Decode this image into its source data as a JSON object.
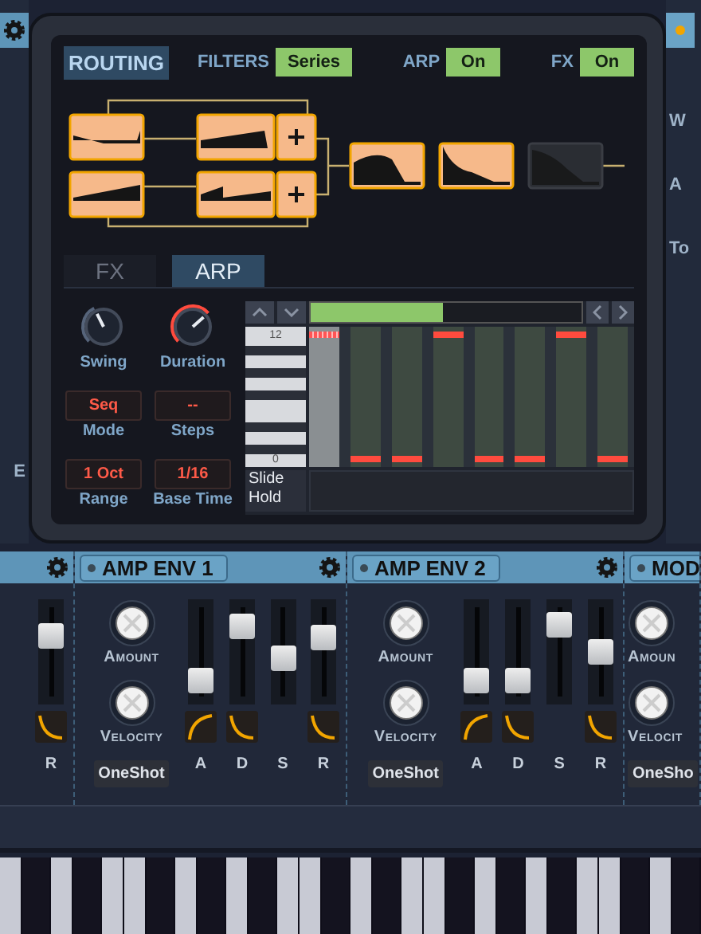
{
  "side_left": {
    "labels": [
      "E"
    ]
  },
  "side_right": {
    "labels": [
      "W",
      "A",
      "To"
    ]
  },
  "routing": {
    "title": "ROUTING",
    "toggles": [
      {
        "label": "FILTERS",
        "value": "Series"
      },
      {
        "label": "ARP",
        "value": "On"
      },
      {
        "label": "FX",
        "value": "On"
      }
    ]
  },
  "tabs": [
    {
      "label": "FX",
      "selected": false
    },
    {
      "label": "ARP",
      "selected": true
    }
  ],
  "arp": {
    "knobs": [
      {
        "label": "Swing",
        "level": 0.4,
        "accent": false
      },
      {
        "label": "Duration",
        "level": 0.68,
        "accent": true
      }
    ],
    "fields": [
      {
        "value": "Seq",
        "label": "Mode"
      },
      {
        "value": "--",
        "label": "Steps"
      },
      {
        "value": "1 Oct",
        "label": "Range"
      },
      {
        "value": "1/16",
        "label": "Base Time"
      }
    ]
  },
  "sequencer": {
    "position": {
      "level": 0.49
    },
    "key_labels": [
      "12",
      "0"
    ],
    "steps": [
      {
        "selected": true,
        "high": true
      },
      {
        "selected": false,
        "high": false
      },
      {
        "selected": false,
        "high": false
      },
      {
        "selected": false,
        "high": true
      },
      {
        "selected": false,
        "high": false
      },
      {
        "selected": false,
        "high": false
      },
      {
        "selected": false,
        "high": true
      },
      {
        "selected": false,
        "high": false
      }
    ],
    "rows": [
      "Slide",
      "Hold"
    ]
  },
  "modules": [
    {
      "kind": "partial-left",
      "sliders": [
        {
          "label": "R",
          "level": 0.7,
          "kind": "fall"
        }
      ]
    },
    {
      "kind": "envelope",
      "title": "AMP ENV 1",
      "knobs": [
        "Amount",
        "Velocity"
      ],
      "button": "OneShot",
      "sliders": [
        {
          "label": "A",
          "level": 0.15,
          "kind": "rise"
        },
        {
          "label": "D",
          "level": 0.82,
          "kind": "fall"
        },
        {
          "label": "S",
          "level": 0.42,
          "kind": "flat"
        },
        {
          "label": "R",
          "level": 0.68,
          "kind": "fall"
        }
      ]
    },
    {
      "kind": "envelope",
      "title": "AMP ENV 2",
      "knobs": [
        "Amount",
        "Velocity"
      ],
      "button": "OneShot",
      "sliders": [
        {
          "label": "A",
          "level": 0.15,
          "kind": "rise"
        },
        {
          "label": "D",
          "level": 0.15,
          "kind": "fall"
        },
        {
          "label": "S",
          "level": 0.85,
          "kind": "flat"
        },
        {
          "label": "R",
          "level": 0.5,
          "kind": "fall"
        }
      ]
    },
    {
      "kind": "partial-right",
      "title": "MOD",
      "knobs": [
        "Amoun",
        "Velocit"
      ],
      "button": "OneSho"
    }
  ]
}
